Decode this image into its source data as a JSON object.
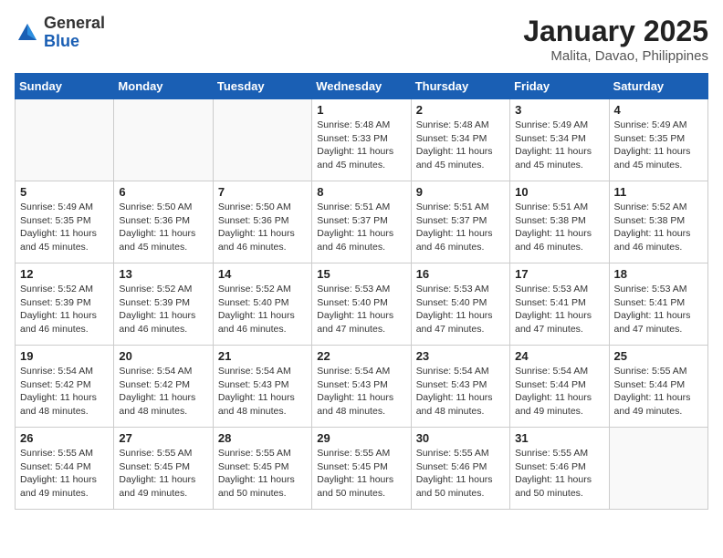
{
  "header": {
    "logo_general": "General",
    "logo_blue": "Blue",
    "main_title": "January 2025",
    "subtitle": "Malita, Davao, Philippines"
  },
  "weekdays": [
    "Sunday",
    "Monday",
    "Tuesday",
    "Wednesday",
    "Thursday",
    "Friday",
    "Saturday"
  ],
  "weeks": [
    [
      {
        "day": "",
        "info": ""
      },
      {
        "day": "",
        "info": ""
      },
      {
        "day": "",
        "info": ""
      },
      {
        "day": "1",
        "info": "Sunrise: 5:48 AM\nSunset: 5:33 PM\nDaylight: 11 hours\nand 45 minutes."
      },
      {
        "day": "2",
        "info": "Sunrise: 5:48 AM\nSunset: 5:34 PM\nDaylight: 11 hours\nand 45 minutes."
      },
      {
        "day": "3",
        "info": "Sunrise: 5:49 AM\nSunset: 5:34 PM\nDaylight: 11 hours\nand 45 minutes."
      },
      {
        "day": "4",
        "info": "Sunrise: 5:49 AM\nSunset: 5:35 PM\nDaylight: 11 hours\nand 45 minutes."
      }
    ],
    [
      {
        "day": "5",
        "info": "Sunrise: 5:49 AM\nSunset: 5:35 PM\nDaylight: 11 hours\nand 45 minutes."
      },
      {
        "day": "6",
        "info": "Sunrise: 5:50 AM\nSunset: 5:36 PM\nDaylight: 11 hours\nand 45 minutes."
      },
      {
        "day": "7",
        "info": "Sunrise: 5:50 AM\nSunset: 5:36 PM\nDaylight: 11 hours\nand 46 minutes."
      },
      {
        "day": "8",
        "info": "Sunrise: 5:51 AM\nSunset: 5:37 PM\nDaylight: 11 hours\nand 46 minutes."
      },
      {
        "day": "9",
        "info": "Sunrise: 5:51 AM\nSunset: 5:37 PM\nDaylight: 11 hours\nand 46 minutes."
      },
      {
        "day": "10",
        "info": "Sunrise: 5:51 AM\nSunset: 5:38 PM\nDaylight: 11 hours\nand 46 minutes."
      },
      {
        "day": "11",
        "info": "Sunrise: 5:52 AM\nSunset: 5:38 PM\nDaylight: 11 hours\nand 46 minutes."
      }
    ],
    [
      {
        "day": "12",
        "info": "Sunrise: 5:52 AM\nSunset: 5:39 PM\nDaylight: 11 hours\nand 46 minutes."
      },
      {
        "day": "13",
        "info": "Sunrise: 5:52 AM\nSunset: 5:39 PM\nDaylight: 11 hours\nand 46 minutes."
      },
      {
        "day": "14",
        "info": "Sunrise: 5:52 AM\nSunset: 5:40 PM\nDaylight: 11 hours\nand 46 minutes."
      },
      {
        "day": "15",
        "info": "Sunrise: 5:53 AM\nSunset: 5:40 PM\nDaylight: 11 hours\nand 47 minutes."
      },
      {
        "day": "16",
        "info": "Sunrise: 5:53 AM\nSunset: 5:40 PM\nDaylight: 11 hours\nand 47 minutes."
      },
      {
        "day": "17",
        "info": "Sunrise: 5:53 AM\nSunset: 5:41 PM\nDaylight: 11 hours\nand 47 minutes."
      },
      {
        "day": "18",
        "info": "Sunrise: 5:53 AM\nSunset: 5:41 PM\nDaylight: 11 hours\nand 47 minutes."
      }
    ],
    [
      {
        "day": "19",
        "info": "Sunrise: 5:54 AM\nSunset: 5:42 PM\nDaylight: 11 hours\nand 48 minutes."
      },
      {
        "day": "20",
        "info": "Sunrise: 5:54 AM\nSunset: 5:42 PM\nDaylight: 11 hours\nand 48 minutes."
      },
      {
        "day": "21",
        "info": "Sunrise: 5:54 AM\nSunset: 5:43 PM\nDaylight: 11 hours\nand 48 minutes."
      },
      {
        "day": "22",
        "info": "Sunrise: 5:54 AM\nSunset: 5:43 PM\nDaylight: 11 hours\nand 48 minutes."
      },
      {
        "day": "23",
        "info": "Sunrise: 5:54 AM\nSunset: 5:43 PM\nDaylight: 11 hours\nand 48 minutes."
      },
      {
        "day": "24",
        "info": "Sunrise: 5:54 AM\nSunset: 5:44 PM\nDaylight: 11 hours\nand 49 minutes."
      },
      {
        "day": "25",
        "info": "Sunrise: 5:55 AM\nSunset: 5:44 PM\nDaylight: 11 hours\nand 49 minutes."
      }
    ],
    [
      {
        "day": "26",
        "info": "Sunrise: 5:55 AM\nSunset: 5:44 PM\nDaylight: 11 hours\nand 49 minutes."
      },
      {
        "day": "27",
        "info": "Sunrise: 5:55 AM\nSunset: 5:45 PM\nDaylight: 11 hours\nand 49 minutes."
      },
      {
        "day": "28",
        "info": "Sunrise: 5:55 AM\nSunset: 5:45 PM\nDaylight: 11 hours\nand 50 minutes."
      },
      {
        "day": "29",
        "info": "Sunrise: 5:55 AM\nSunset: 5:45 PM\nDaylight: 11 hours\nand 50 minutes."
      },
      {
        "day": "30",
        "info": "Sunrise: 5:55 AM\nSunset: 5:46 PM\nDaylight: 11 hours\nand 50 minutes."
      },
      {
        "day": "31",
        "info": "Sunrise: 5:55 AM\nSunset: 5:46 PM\nDaylight: 11 hours\nand 50 minutes."
      },
      {
        "day": "",
        "info": ""
      }
    ]
  ]
}
